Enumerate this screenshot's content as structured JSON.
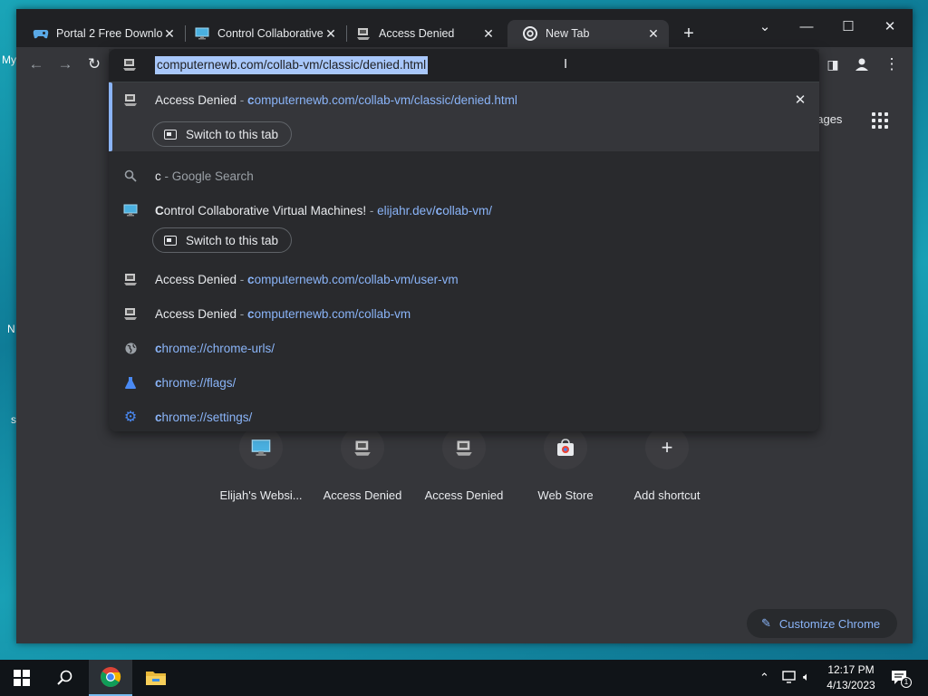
{
  "desktop": {
    "fragments": [
      "My",
      "N",
      "s"
    ]
  },
  "tabs": [
    {
      "title": "Portal 2 Free Downlo",
      "icon": "gamepad-icon"
    },
    {
      "title": "Control Collaborative",
      "icon": "monitor-icon"
    },
    {
      "title": "Access Denied",
      "icon": "vm-icon"
    },
    {
      "title": "New Tab",
      "icon": "chrome-icon",
      "active": true
    }
  ],
  "toolbar": {
    "address_value": "computernewb.com/collab-vm/classic/denied.html"
  },
  "omnibox": {
    "top_result": {
      "title": "Access Denied",
      "sep": " - ",
      "match": "c",
      "url_rest": "omputernewb.com/collab-vm/classic/denied.html",
      "switch_label": "Switch to this tab"
    },
    "search_row": {
      "query": "c",
      "suffix": " - Google Search"
    },
    "collab_row": {
      "title_match": "C",
      "title_rest": "ontrol Collaborative Virtual Machines!",
      "sep": " - ",
      "url_a": "elijahr.dev/",
      "url_match": "c",
      "url_b": "ollab-vm/",
      "switch_label": "Switch to this tab"
    },
    "rows": [
      {
        "title": "Access Denied",
        "sep": " - ",
        "match": "c",
        "url_rest": "omputernewb.com/collab-vm/user-vm",
        "icon": "vm-icon"
      },
      {
        "title": "Access Denied",
        "sep": " - ",
        "match": "c",
        "url_rest": "omputernewb.com/collab-vm",
        "icon": "vm-icon"
      }
    ],
    "chrome_rows": [
      {
        "match": "c",
        "rest": "hrome://chrome-urls/",
        "icon": "globe-icon"
      },
      {
        "match": "c",
        "rest": "hrome://flags/",
        "icon": "flask-icon"
      },
      {
        "match": "c",
        "rest": "hrome://settings/",
        "icon": "gear-icon"
      }
    ]
  },
  "ntp": {
    "images_label": "nages",
    "shortcuts": [
      {
        "label": "Elijah's Websi...",
        "icon": "monitor-icon"
      },
      {
        "label": "Access Denied",
        "icon": "vm-icon"
      },
      {
        "label": "Access Denied",
        "icon": "vm-icon"
      },
      {
        "label": "Web Store",
        "icon": "webstore-icon"
      },
      {
        "label": "Add shortcut",
        "icon": "plus-icon"
      }
    ],
    "customize_label": "Customize Chrome"
  },
  "taskbar": {
    "time": "12:17 PM",
    "date": "4/13/2023",
    "notification_count": "1"
  },
  "colors": {
    "accent": "#8ab4f8",
    "selection": "#a8c7fa",
    "surface": "#35363a"
  }
}
